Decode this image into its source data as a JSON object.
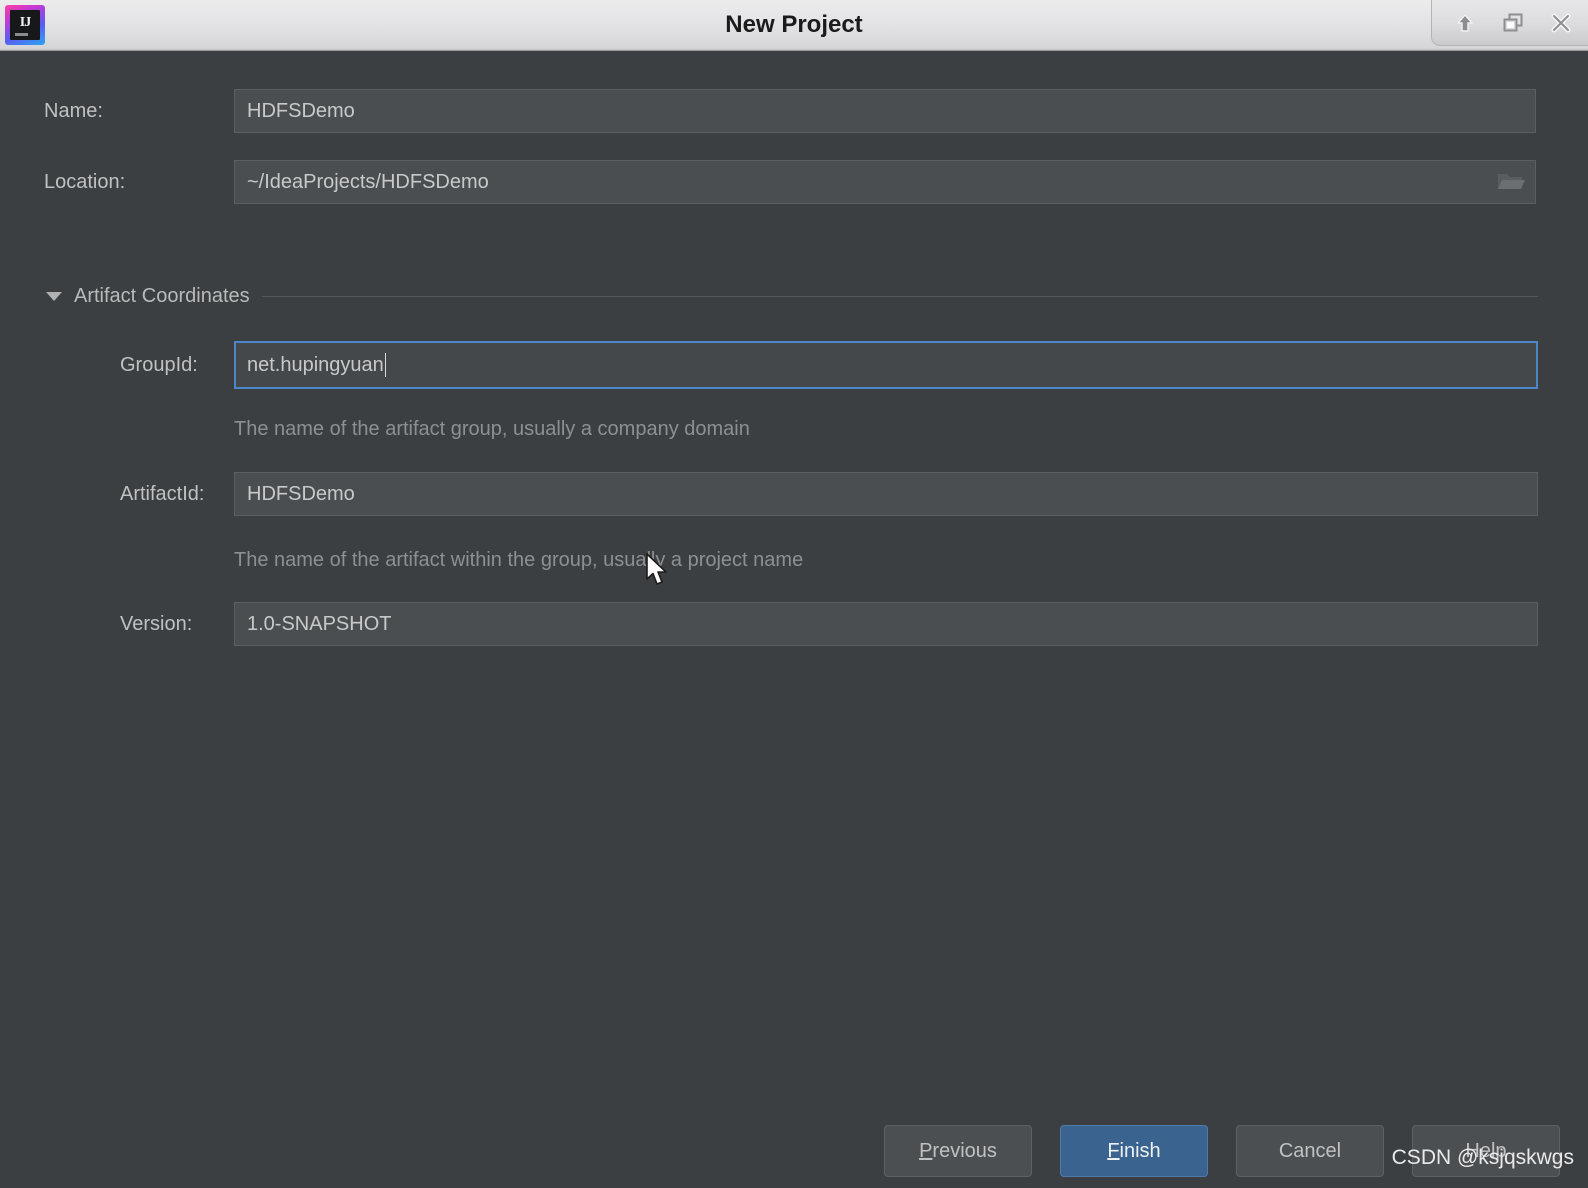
{
  "window": {
    "title": "New Project",
    "app_icon_text": "IJ",
    "controls": [
      {
        "name": "minimize-up-icon",
        "label": "Minimize"
      },
      {
        "name": "restore-icon",
        "label": "Restore"
      },
      {
        "name": "close-icon",
        "label": "Close"
      }
    ]
  },
  "form": {
    "name": {
      "label": "Name:",
      "value": "HDFSDemo"
    },
    "location": {
      "label": "Location:",
      "value": "~/IdeaProjects/HDFSDemo",
      "browse_icon": "folder-icon"
    },
    "section": {
      "title": "Artifact Coordinates",
      "expanded": true
    },
    "group_id": {
      "label": "GroupId:",
      "value": "net.hupingyuan",
      "focused": true,
      "helper": "The name of the artifact group, usually a company domain"
    },
    "artifact_id": {
      "label": "ArtifactId:",
      "value": "HDFSDemo",
      "helper": "The name of the artifact within the group, usually a project name"
    },
    "version": {
      "label": "Version:",
      "value": "1.0-SNAPSHOT"
    }
  },
  "buttons": {
    "previous": {
      "mnemonic": "P",
      "rest": "revious"
    },
    "finish": {
      "mnemonic": "F",
      "rest": "inish"
    },
    "cancel": {
      "label": "Cancel"
    },
    "help": {
      "label": "Help"
    }
  },
  "watermark": "CSDN @ksjqskwgs",
  "colors": {
    "dialog_bg": "#3c3f41",
    "field_bg": "#4b4e50",
    "focus_border": "#4b87c7",
    "primary_button": "#3a648f",
    "label_text": "#bfc1c2",
    "helper_text": "#8d9092",
    "titlebar_top": "#ececed",
    "titlebar_bottom": "#d6d6d8"
  }
}
